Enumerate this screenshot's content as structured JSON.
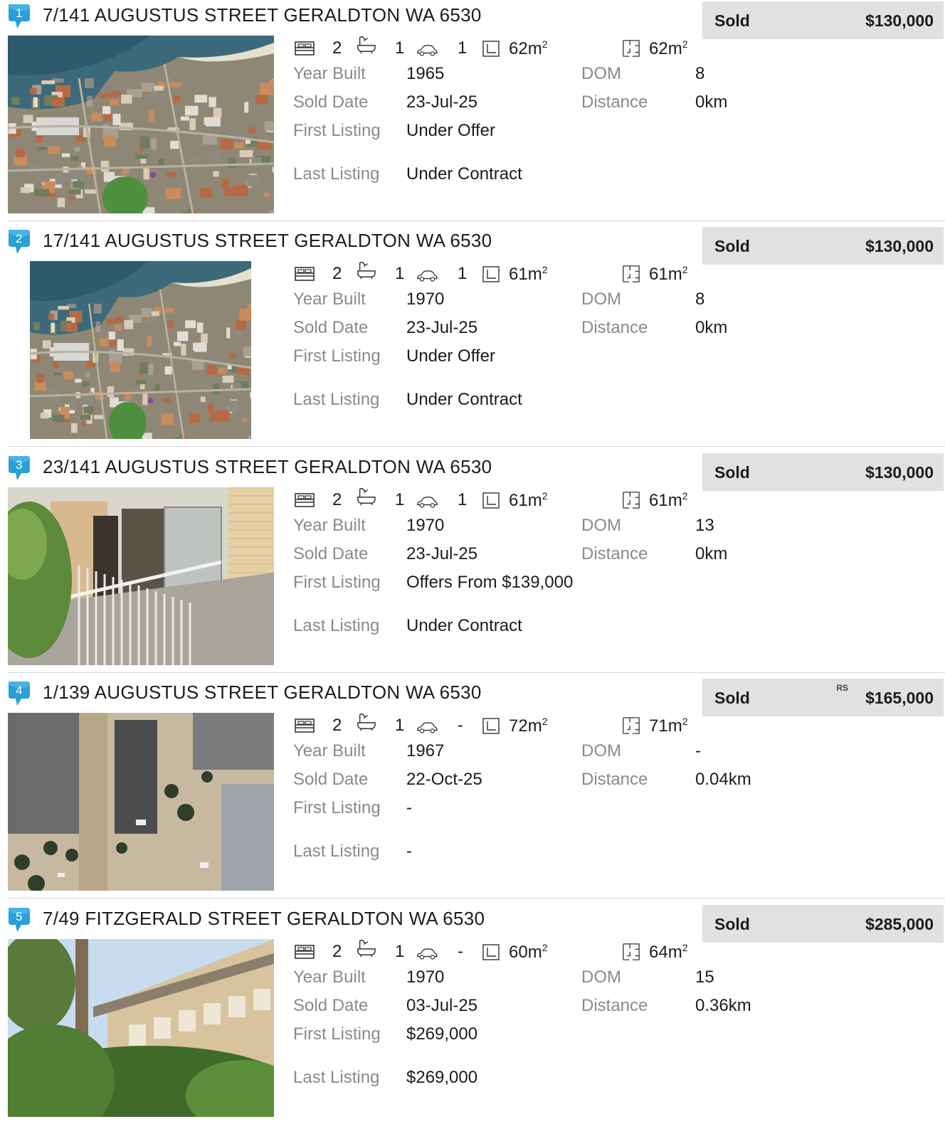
{
  "labels": {
    "year_built": "Year Built",
    "sold_date": "Sold Date",
    "first_listing": "First Listing",
    "last_listing": "Last Listing",
    "dom": "DOM",
    "distance": "Distance",
    "sold": "Sold",
    "rs": "RS",
    "area_unit": "m",
    "area_sup": "2"
  },
  "colors": {
    "pin": "#2a9fd8",
    "sold_box": "#e1e1e1",
    "label": "#8a8a8a"
  },
  "listings": [
    {
      "index": "1",
      "address": "7/141 AUGUSTUS STREET GERALDTON WA 6530",
      "price": "$130,000",
      "beds": "2",
      "baths": "1",
      "cars": "1",
      "land": "62",
      "floor": "62",
      "year_built": "1965",
      "sold_date": "23-Jul-25",
      "first_listing": "Under Offer",
      "last_listing": "Under Contract",
      "dom": "8",
      "distance": "0km",
      "photo": "aerial-map"
    },
    {
      "index": "2",
      "address": "17/141 AUGUSTUS STREET GERALDTON WA 6530",
      "price": "$130,000",
      "beds": "2",
      "baths": "1",
      "cars": "1",
      "land": "61",
      "floor": "61",
      "year_built": "1970",
      "sold_date": "23-Jul-25",
      "first_listing": "Under Offer",
      "last_listing": "Under Contract",
      "dom": "8",
      "distance": "0km",
      "photo": "aerial-map"
    },
    {
      "index": "3",
      "address": "23/141 AUGUSTUS STREET GERALDTON WA 6530",
      "price": "$130,000",
      "beds": "2",
      "baths": "1",
      "cars": "1",
      "land": "61",
      "floor": "61",
      "year_built": "1970",
      "sold_date": "23-Jul-25",
      "first_listing": "Offers From $139,000",
      "last_listing": "Under Contract",
      "dom": "13",
      "distance": "0km",
      "photo": "balcony-photo"
    },
    {
      "index": "4",
      "address": "1/139 AUGUSTUS STREET GERALDTON WA 6530",
      "price": "$165,000",
      "rs": true,
      "beds": "2",
      "baths": "1",
      "cars": "-",
      "land": "72",
      "floor": "71",
      "year_built": "1967",
      "sold_date": "22-Oct-25",
      "first_listing": "-",
      "last_listing": "-",
      "dom": "-",
      "distance": "0.04km",
      "photo": "satellite-closeup"
    },
    {
      "index": "5",
      "address": "7/49 FITZGERALD STREET GERALDTON WA 6530",
      "price": "$285,000",
      "beds": "2",
      "baths": "1",
      "cars": "-",
      "land": "60",
      "floor": "64",
      "year_built": "1970",
      "sold_date": "03-Jul-25",
      "first_listing": "$269,000",
      "last_listing": "$269,000",
      "dom": "15",
      "distance": "0.36km",
      "photo": "garden-photo"
    }
  ]
}
